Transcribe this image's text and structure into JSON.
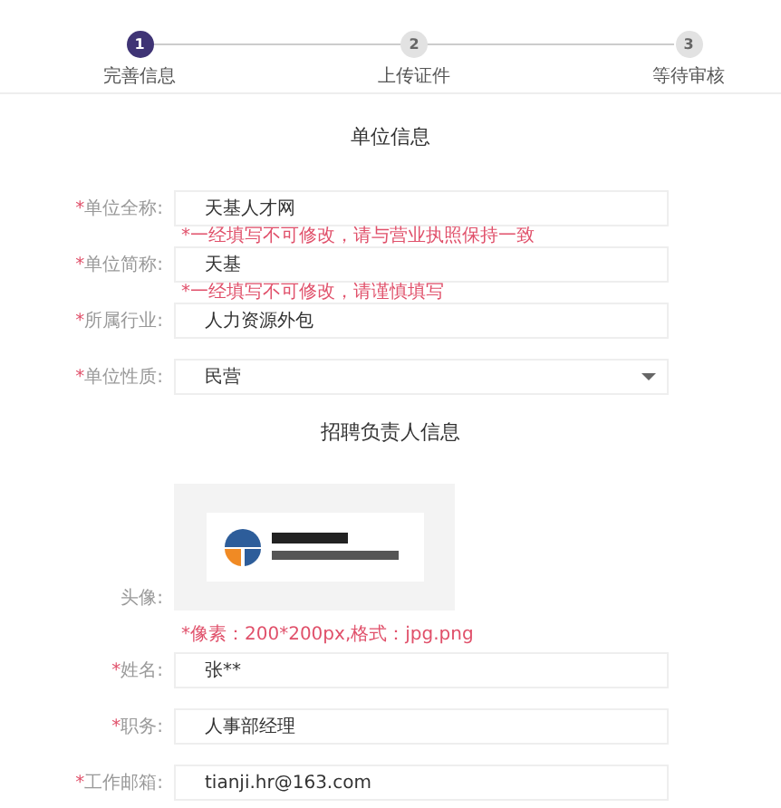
{
  "steps": [
    {
      "number": "1",
      "label": "完善信息",
      "selected": true
    },
    {
      "number": "2",
      "label": "上传证件",
      "selected": false
    },
    {
      "number": "3",
      "label": "等待审核",
      "selected": false
    }
  ],
  "sections": [
    {
      "title": "单位信息",
      "fields": [
        {
          "kind": "text",
          "required_mark": "*",
          "label": "单位全称:",
          "value": "天基人才网",
          "hint": "*一经填写不可修改，请与营业执照保持一致"
        },
        {
          "kind": "text",
          "required_mark": "*",
          "label": "单位简称:",
          "value": "天基",
          "hint": "*一经填写不可修改，请谨慎填写"
        },
        {
          "kind": "text",
          "required_mark": "*",
          "label": "所属行业:",
          "value": "人力资源外包"
        },
        {
          "kind": "select",
          "required_mark": "*",
          "label": "单位性质:",
          "value": "民营"
        }
      ]
    },
    {
      "title": "招聘负责人信息",
      "fields": [
        {
          "kind": "avatar",
          "label": "头像:",
          "hint": "*像素：200*200px,格式：jpg.png"
        },
        {
          "kind": "text",
          "required_mark": "*",
          "label": "姓名:",
          "value": "张**"
        },
        {
          "kind": "text",
          "required_mark": "*",
          "label": "职务:",
          "value": "人事部经理"
        },
        {
          "kind": "text",
          "required_mark": "*",
          "label": "工作邮箱:",
          "value": "tianji.hr@163.com"
        }
      ]
    }
  ]
}
